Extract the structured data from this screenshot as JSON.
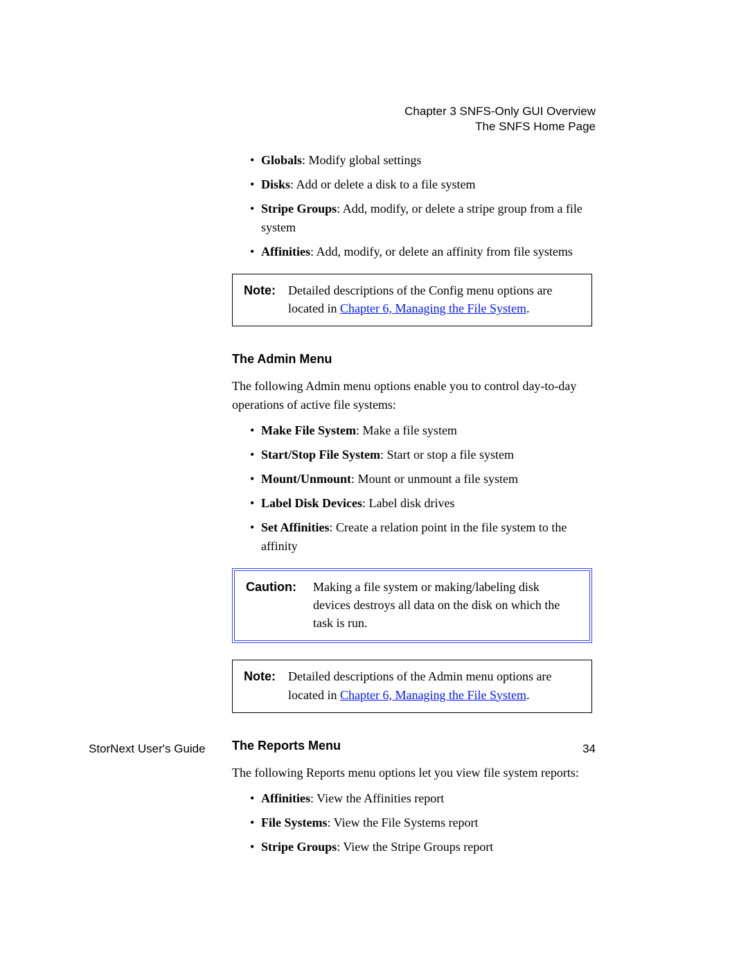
{
  "header": {
    "chapter_line": "Chapter 3  SNFS-Only GUI Overview",
    "subline": "The SNFS Home Page"
  },
  "config_list": [
    {
      "term": "Globals",
      "desc": ": Modify global settings"
    },
    {
      "term": "Disks",
      "desc": ": Add or delete a disk to a file system"
    },
    {
      "term": "Stripe Groups",
      "desc": ": Add, modify, or delete a stripe group from a file system"
    },
    {
      "term": "Affinities",
      "desc": ": Add, modify, or delete an affinity from file systems"
    }
  ],
  "note1": {
    "label": "Note:",
    "body_prefix": "Detailed descriptions of the Config menu options are located in ",
    "link_text": "Chapter 6, Managing the File System",
    "body_suffix": "."
  },
  "admin": {
    "heading": "The Admin Menu",
    "intro": "The following Admin menu options enable you to control day-to-day operations of active file systems:",
    "items": [
      {
        "term": "Make File System",
        "desc": ": Make a file system"
      },
      {
        "term": "Start/Stop File System",
        "desc": ": Start or stop a file system"
      },
      {
        "term": "Mount/Unmount",
        "desc": ": Mount or unmount a file system"
      },
      {
        "term": "Label Disk Devices",
        "desc": ": Label disk drives"
      },
      {
        "term": "Set Affinities",
        "desc": ": Create a relation point in the file system to the affinity"
      }
    ]
  },
  "caution": {
    "label": "Caution:",
    "body": "Making a file system or making/labeling disk devices destroys all data on the disk on which the task is run."
  },
  "note2": {
    "label": "Note:",
    "body_prefix": "Detailed descriptions of the Admin menu options are located in ",
    "link_text": "Chapter 6, Managing the File System",
    "body_suffix": "."
  },
  "reports": {
    "heading": "The Reports Menu",
    "intro": "The following Reports menu options let you view file system reports:",
    "items": [
      {
        "term": "Affinities",
        "desc": ": View the Affinities report"
      },
      {
        "term": "File Systems",
        "desc": ": View the File Systems report"
      },
      {
        "term": "Stripe Groups",
        "desc": ": View the Stripe Groups report"
      }
    ]
  },
  "footer": {
    "doc_title": "StorNext User's Guide",
    "page_number": "34"
  }
}
